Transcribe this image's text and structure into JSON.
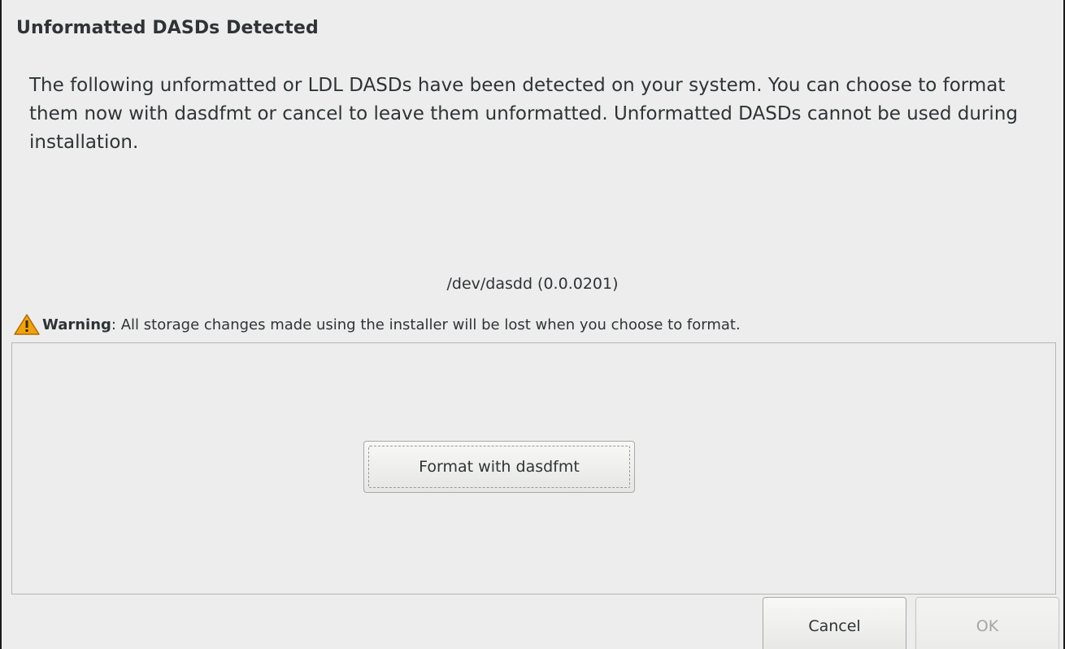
{
  "dialog": {
    "title": "Unformatted DASDs Detected",
    "message": "The following unformatted or LDL DASDs have been detected on your system. You can choose to format them now with dasdfmt or cancel to leave them unformatted. Unformatted DASDs cannot be used during installation.",
    "device": "/dev/dasdd (0.0.0201)",
    "warning": {
      "icon": "warning-triangle-icon",
      "label": "Warning",
      "separator": ":",
      "text": " All storage changes made using the installer will be lost when you choose to format."
    },
    "format_button_label": "Format with dasdfmt",
    "cancel_label": "Cancel",
    "ok_label": "OK",
    "ok_enabled": false,
    "colors": {
      "warning_fill": "#f0a30a",
      "disabled_text": "#a3a5a5"
    }
  }
}
